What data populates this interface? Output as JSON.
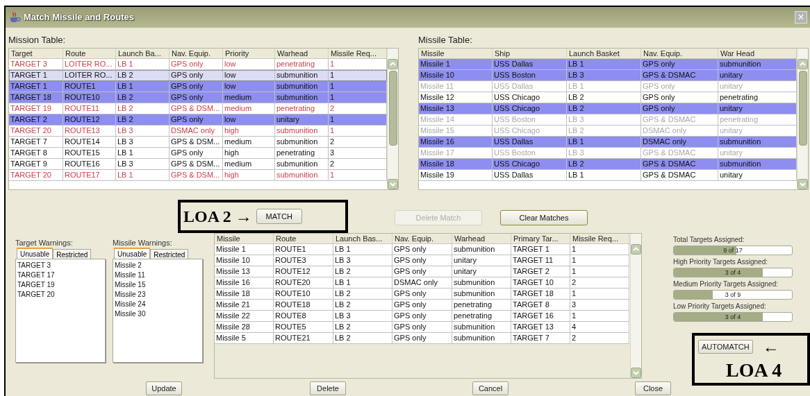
{
  "window": {
    "title": "Match Missile and Routes",
    "close": "×"
  },
  "mission_table": {
    "label": "Mission Table:",
    "columns": [
      "Target",
      "Route",
      "Launch Ba...",
      "Nav. Equip.",
      "Priority",
      "Warhead",
      "Missile Req..."
    ],
    "rows": [
      {
        "cells": [
          "TARGET 3",
          "LOITER RO...",
          "LB 1",
          "GPS only",
          "low",
          "penetrating",
          "1"
        ],
        "unusable": true,
        "selected": false,
        "focused": false
      },
      {
        "cells": [
          "TARGET 1",
          "LOITER RO...",
          "LB 2",
          "GPS only",
          "low",
          "submunition",
          "1"
        ],
        "unusable": false,
        "selected": false,
        "focused": true
      },
      {
        "cells": [
          "TARGET 1",
          "ROUTE1",
          "LB 1",
          "GPS only",
          "low",
          "submunition",
          "1"
        ],
        "unusable": false,
        "selected": true,
        "focused": false
      },
      {
        "cells": [
          "TARGET 18",
          "ROUTE10",
          "LB 2",
          "GPS only",
          "medium",
          "submunition",
          "1"
        ],
        "unusable": false,
        "selected": true,
        "focused": false
      },
      {
        "cells": [
          "TARGET 19",
          "ROUTE11",
          "LB 2",
          "GPS & DSM...",
          "medium",
          "penetrating",
          "2"
        ],
        "unusable": true,
        "selected": false,
        "focused": false
      },
      {
        "cells": [
          "TARGET 2",
          "ROUTE12",
          "LB 2",
          "GPS only",
          "low",
          "unitary",
          "1"
        ],
        "unusable": false,
        "selected": true,
        "focused": false
      },
      {
        "cells": [
          "TARGET 20",
          "ROUTE13",
          "LB 3",
          "DSMAC only",
          "high",
          "submunition",
          "1"
        ],
        "unusable": true,
        "selected": false,
        "focused": false
      },
      {
        "cells": [
          "TARGET 7",
          "ROUTE14",
          "LB 3",
          "GPS & DSM...",
          "medium",
          "submunition",
          "2"
        ],
        "unusable": false,
        "selected": false,
        "focused": false
      },
      {
        "cells": [
          "TARGET 8",
          "ROUTE15",
          "LB 1",
          "GPS only",
          "high",
          "penetrating",
          "3"
        ],
        "unusable": false,
        "selected": false,
        "focused": false
      },
      {
        "cells": [
          "TARGET 9",
          "ROUTE16",
          "LB 3",
          "GPS & DSM...",
          "medium",
          "submunition",
          "2"
        ],
        "unusable": false,
        "selected": false,
        "focused": false
      },
      {
        "cells": [
          "TARGET 20",
          "ROUTE17",
          "LB 1",
          "GPS & DSM...",
          "high",
          "submunition",
          "1"
        ],
        "unusable": true,
        "selected": false,
        "focused": false
      }
    ]
  },
  "missile_table": {
    "label": "Missile Table:",
    "columns": [
      "Missile",
      "Ship",
      "Launch Basket",
      "Nav. Equip.",
      "War Head"
    ],
    "rows": [
      {
        "cells": [
          "Missile 1",
          "USS Dallas",
          "LB 1",
          "GPS only",
          "submunition"
        ],
        "selected": true,
        "unavailable": false
      },
      {
        "cells": [
          "Missile 10",
          "USS Boston",
          "LB 3",
          "GPS & DSMAC",
          "unitary"
        ],
        "selected": true,
        "unavailable": false
      },
      {
        "cells": [
          "Missile 11",
          "USS Dallas",
          "LB 1",
          "GPS only",
          "unitary"
        ],
        "selected": false,
        "unavailable": true
      },
      {
        "cells": [
          "Missile 12",
          "USS Chicago",
          "LB 2",
          "GPS only",
          "penetrating"
        ],
        "selected": false,
        "unavailable": false
      },
      {
        "cells": [
          "Missile 13",
          "USS Chicago",
          "LB 2",
          "GPS only",
          "unitary"
        ],
        "selected": true,
        "unavailable": false
      },
      {
        "cells": [
          "Missile 14",
          "USS Boston",
          "LB 3",
          "GPS & DSMAC",
          "penetrating"
        ],
        "selected": false,
        "unavailable": true
      },
      {
        "cells": [
          "Missile 15",
          "USS Chicago",
          "LB 2",
          "DSMAC only",
          "unitary"
        ],
        "selected": false,
        "unavailable": true
      },
      {
        "cells": [
          "Missile 16",
          "USS Dallas",
          "LB 1",
          "DSMAC only",
          "submunition"
        ],
        "selected": true,
        "unavailable": false
      },
      {
        "cells": [
          "Missile 17",
          "USS Boston",
          "LB 3",
          "GPS & DSMAC",
          "unitary"
        ],
        "selected": false,
        "unavailable": true
      },
      {
        "cells": [
          "Missile 18",
          "USS Chicago",
          "LB 2",
          "GPS & DSMAC",
          "submunition"
        ],
        "selected": true,
        "unavailable": false
      },
      {
        "cells": [
          "Missile 19",
          "USS Dallas",
          "LB 1",
          "GPS & DSMAC",
          "unitary"
        ],
        "selected": false,
        "unavailable": false
      }
    ]
  },
  "match_buttons": [
    {
      "label": "MATCH",
      "disabled": false,
      "default": false
    },
    {
      "label": "Delete Match",
      "disabled": true,
      "default": false
    },
    {
      "label": "Clear Matches",
      "disabled": false,
      "default": true
    }
  ],
  "target_warnings": {
    "label": "Target Warnings:",
    "tabs": [
      {
        "label": "Unusable",
        "selected": true
      },
      {
        "label": "Restricted",
        "selected": false
      }
    ],
    "items": [
      "TARGET 3",
      "TARGET 17",
      "TARGET 19",
      "TARGET 20"
    ]
  },
  "missile_warnings": {
    "label": "Missile Warnings:",
    "tabs": [
      {
        "label": "Unusable",
        "selected": true
      },
      {
        "label": "Restricted",
        "selected": false
      }
    ],
    "items": [
      "Missile 2",
      "Missile 11",
      "Missile 15",
      "Missile 23",
      "Missile 24",
      "Missile 30"
    ]
  },
  "matches_table": {
    "columns": [
      "Missile",
      "Route",
      "Launch Bas...",
      "Nav. Equip.",
      "Warhead",
      "Primary Tar...",
      "Missile Req..."
    ],
    "rows": [
      [
        "Missile 1",
        "ROUTE1",
        "LB 1",
        "GPS only",
        "submunition",
        "TARGET 1",
        "1"
      ],
      [
        "Missile 10",
        "ROUTE3",
        "LB 3",
        "GPS only",
        "unitary",
        "TARGET 11",
        "1"
      ],
      [
        "Missile 13",
        "ROUTE12",
        "LB 2",
        "GPS only",
        "unitary",
        "TARGET 2",
        "1"
      ],
      [
        "Missile 16",
        "ROUTE20",
        "LB 1",
        "DSMAC only",
        "submunition",
        "TARGET 10",
        "2"
      ],
      [
        "Missile 18",
        "ROUTE10",
        "LB 2",
        "GPS only",
        "submunition",
        "TARGET 18",
        "1"
      ],
      [
        "Missile 21",
        "ROUTE18",
        "LB 2",
        "GPS only",
        "penetrating",
        "TARGET 8",
        "3"
      ],
      [
        "Missile 22",
        "ROUTE8",
        "LB 3",
        "GPS only",
        "penetrating",
        "TARGET 16",
        "1"
      ],
      [
        "Missile 28",
        "ROUTE5",
        "LB 2",
        "GPS only",
        "submunition",
        "TARGET 13",
        "4"
      ],
      [
        "Missile 5",
        "ROUTE21",
        "LB 2",
        "GPS only",
        "submunition",
        "TARGET 7",
        "2"
      ]
    ]
  },
  "progress": [
    {
      "label": "Total Targets Assigned:",
      "reading": "9 of 17",
      "level": 0.53
    },
    {
      "label": "High Priority Targets Assigned:",
      "reading": "3 of 4",
      "level": 0.75
    },
    {
      "label": "Medium Priority Targets Assigned:",
      "reading": "3 of 9",
      "level": 0.33
    },
    {
      "label": "Low Priority Targets Assigned:",
      "reading": "3 of 4",
      "level": 0.75
    }
  ],
  "automatch": {
    "label": "AUTOMATCH"
  },
  "bottom_buttons": [
    "Update",
    "Delete",
    "Cancel",
    "Close"
  ],
  "annotations": [
    {
      "label": "LOA 2",
      "arrow": "→"
    },
    {
      "label": "LOA 4",
      "arrow": "←"
    }
  ]
}
